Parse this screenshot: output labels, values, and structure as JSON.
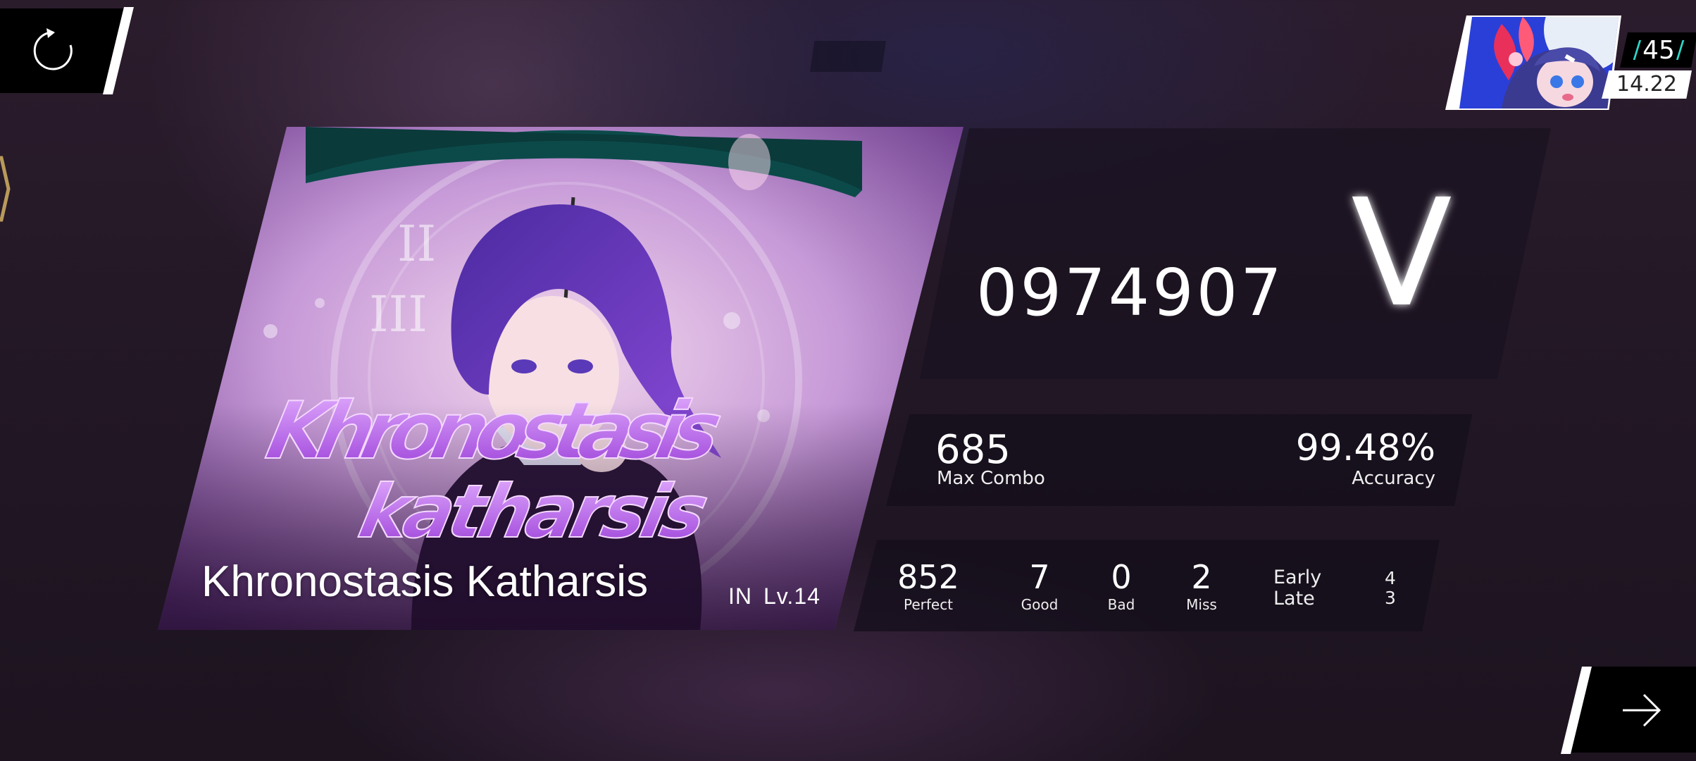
{
  "song": {
    "title": "Khronostasis Katharsis",
    "difficulty": "IN",
    "level": "Lv.14",
    "art_title_line1": "Khronostasis",
    "art_title_line2": "katharsis"
  },
  "player": {
    "level": "45",
    "rks": "14.22"
  },
  "result": {
    "score": "0974907",
    "rank": "V",
    "max_combo": "685",
    "max_combo_label": "Max Combo",
    "accuracy": "99.48%",
    "accuracy_label": "Accuracy",
    "perfect": "852",
    "perfect_label": "Perfect",
    "good": "7",
    "good_label": "Good",
    "bad": "0",
    "bad_label": "Bad",
    "miss": "2",
    "miss_label": "Miss",
    "early_label": "Early",
    "late_label": "Late",
    "early": "4",
    "late": "3"
  },
  "icons": {
    "retry": "retry-icon",
    "next": "arrow-right-icon"
  },
  "colors": {
    "accent_cyan": "#2fd7c8",
    "art_purple": "#a35ad8"
  }
}
